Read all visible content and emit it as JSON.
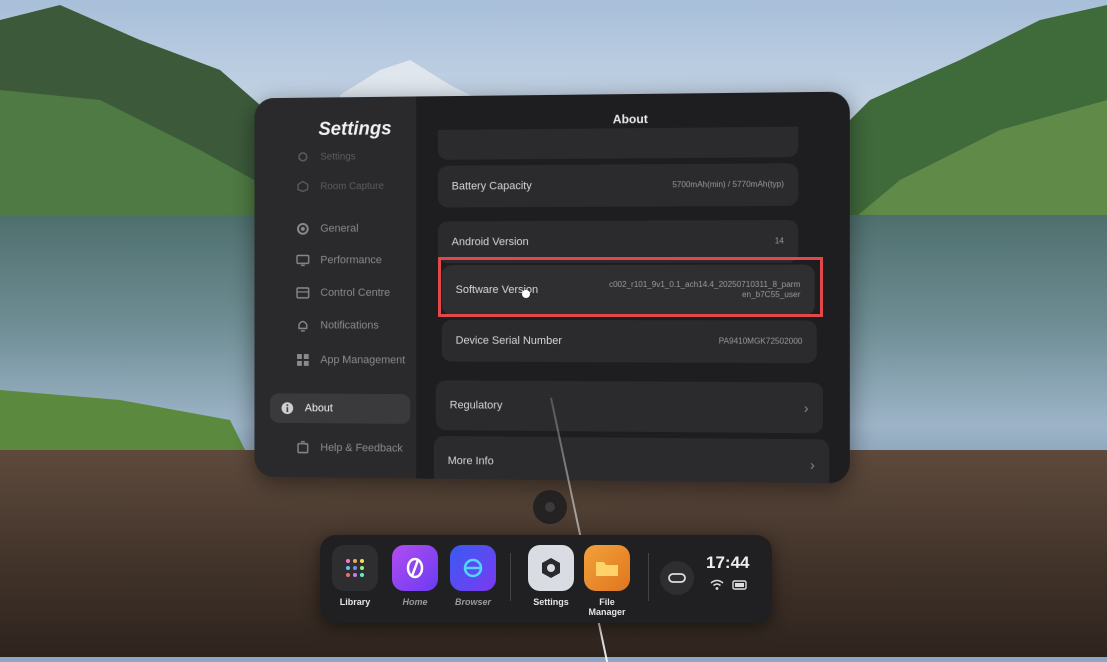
{
  "settings": {
    "title": "Settings",
    "nav": [
      {
        "label": "Settings",
        "icon": "settings-icon",
        "faint": true
      },
      {
        "label": "Room Capture",
        "icon": "room-capture-icon",
        "faint": true
      },
      {
        "label": "General",
        "icon": "general-icon"
      },
      {
        "label": "Performance",
        "icon": "performance-icon"
      },
      {
        "label": "Control Centre",
        "icon": "control-centre-icon"
      },
      {
        "label": "Notifications",
        "icon": "bell-icon"
      },
      {
        "label": "App Management",
        "icon": "apps-grid-icon"
      },
      {
        "label": "About",
        "icon": "info-icon",
        "active": true
      },
      {
        "label": "Help & Feedback",
        "icon": "help-icon"
      }
    ]
  },
  "about": {
    "header": "About",
    "rows": {
      "top_partial": {
        "label": "",
        "value": ""
      },
      "battery": {
        "label": "Battery Capacity",
        "value": "5700mAh(min) / 5770mAh(typ)"
      },
      "android": {
        "label": "Android Version",
        "value": "14"
      },
      "software": {
        "label": "Software Version",
        "value": "c002_r101_9v1_0.1_ach14.4_20250710311_8_parmen_b7C55_user"
      },
      "serial": {
        "label": "Device Serial Number",
        "value": "PA9410MGK72502000"
      },
      "regulatory": {
        "label": "Regulatory",
        "chevron": "›"
      },
      "more_info": {
        "label": "More Info",
        "chevron": "›"
      }
    }
  },
  "dock": {
    "apps": [
      {
        "label": "Library",
        "icon": "library-icon",
        "dim": false
      },
      {
        "label": "Home",
        "icon": "home-icon",
        "dim": true
      },
      {
        "label": "Browser",
        "icon": "browser-icon",
        "dim": true
      },
      {
        "label": "Settings",
        "icon": "settings-app-icon",
        "dim": false
      },
      {
        "label": "File Manager",
        "icon": "folder-icon",
        "dim": false
      }
    ],
    "time": "17:44",
    "status_icons": [
      "wifi-icon",
      "battery-icon"
    ]
  },
  "colors": {
    "highlight": "#e2474a",
    "panel": "#1e1e20",
    "sidebar": "#2a2a2c"
  }
}
